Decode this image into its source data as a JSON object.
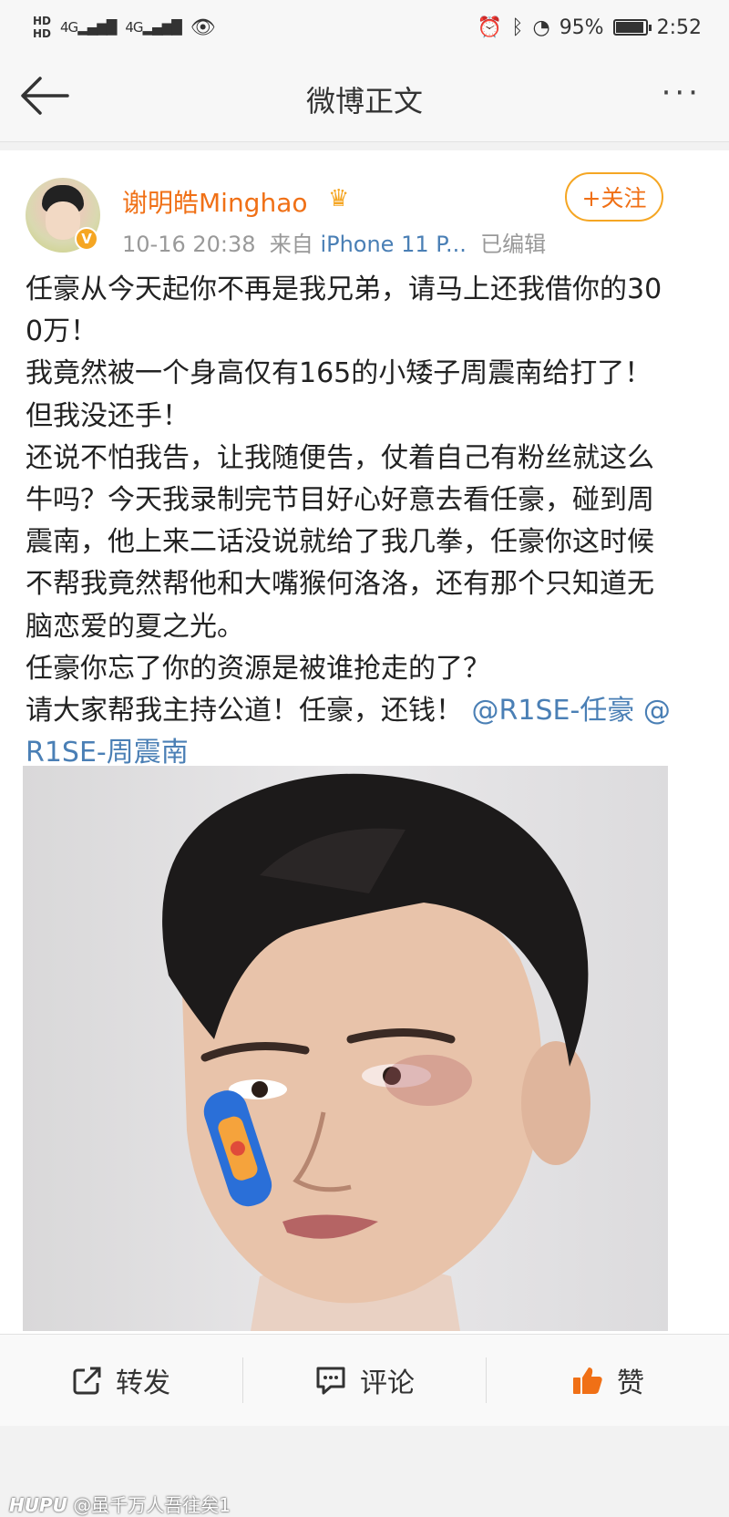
{
  "status_bar": {
    "hd1": "HD",
    "hd2": "HD",
    "net1": "4G",
    "net2": "4G",
    "battery_percent": 95,
    "battery_text": "95%",
    "time": "2:52"
  },
  "nav": {
    "title": "微博正文",
    "more": "···"
  },
  "post": {
    "author": "谢明皓Minghao",
    "vip_badge": "V",
    "follow_label": "+关注",
    "time": "10-16 20:38",
    "source_prefix": "来自",
    "device": "iPhone 11 P...",
    "edited": "已编辑",
    "paragraphs": [
      "任豪从今天起你不再是我兄弟，请马上还我借你的300万！",
      "我竟然被一个身高仅有165的小矮子周震南给打了！但我没还手！",
      "还说不怕我告，让我随便告，仗着自己有粉丝就这么牛吗？今天我录制完节目好心好意去看任豪，碰到周震南，他上来二话没说就给了我几拳，任豪你这时候不帮我竟然帮他和大嘴猴何洛洛，还有那个只知道无脑恋爱的夏之光。",
      "任豪你忘了你的资源是被谁抢走的了？"
    ],
    "last_line": "请大家帮我主持公道！任豪，还钱！",
    "mentions": [
      "@R1SE-任豪",
      "@R1SE-周震南"
    ]
  },
  "actions": {
    "repost": "转发",
    "comment": "评论",
    "like": "赞"
  },
  "watermark": {
    "brand": "HUPU",
    "user": "@虽千万人吾往矣1"
  },
  "colors": {
    "accent_orange": "#f07016",
    "link_blue": "#4a7fb5",
    "like_orange": "#f5a623"
  }
}
